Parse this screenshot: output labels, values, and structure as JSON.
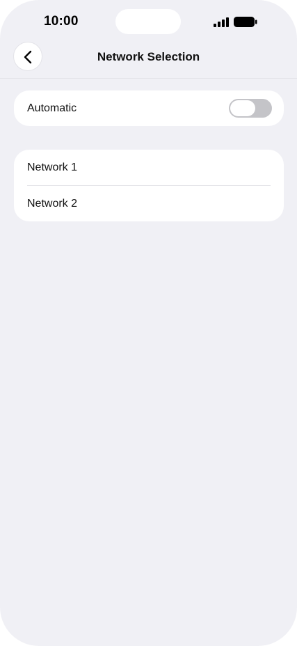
{
  "status_bar": {
    "time": "10:00",
    "signal_icon": "cellular-signal-icon",
    "battery_icon": "battery-full-icon"
  },
  "nav": {
    "back_icon": "chevron-left-icon",
    "title": "Network Selection"
  },
  "automatic": {
    "label": "Automatic",
    "toggle_on": false
  },
  "networks": [
    {
      "label": "Network 1"
    },
    {
      "label": "Network 2"
    }
  ],
  "colors": {
    "background": "#f0f0f5",
    "card": "#ffffff",
    "toggle_off": "#c4c4c8"
  }
}
